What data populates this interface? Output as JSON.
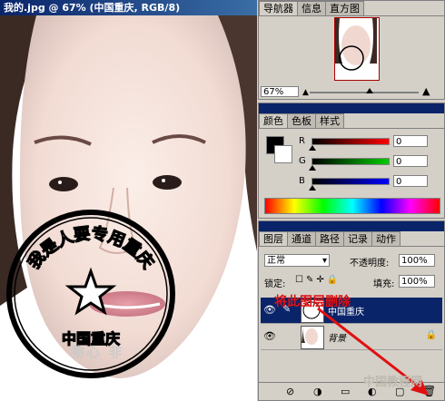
{
  "document": {
    "title": "我的.jpg @ 67% (中国重庆, RGB/8)",
    "stamp_text_top": "我是人要专用重庆",
    "stamp_text_bottom": "中国重庆",
    "watermark": "物心 非"
  },
  "navigator": {
    "tabs": [
      "导航器",
      "信息",
      "直方图"
    ],
    "zoom": "67%"
  },
  "color": {
    "tabs": [
      "颜色",
      "色板",
      "样式"
    ],
    "channels": [
      {
        "label": "R",
        "value": "0",
        "color": "#ff0000"
      },
      {
        "label": "G",
        "value": "0",
        "color": "#00aa00"
      },
      {
        "label": "B",
        "value": "0",
        "color": "#0000ff"
      }
    ]
  },
  "layers": {
    "tabs": [
      "图层",
      "通道",
      "路径",
      "记录",
      "动作"
    ],
    "blend_mode": "正常",
    "opacity_label": "不透明度:",
    "opacity_value": "100%",
    "lock_label": "锁定:",
    "fill_label": "填充:",
    "fill_value": "100%",
    "items": [
      {
        "name": "中国重庆",
        "selected": true
      },
      {
        "name": "背景",
        "selected": false
      }
    ]
  },
  "annotation": {
    "text": "将此图层删除",
    "color": "#e01010"
  },
  "footer_watermark": "中国教程网"
}
